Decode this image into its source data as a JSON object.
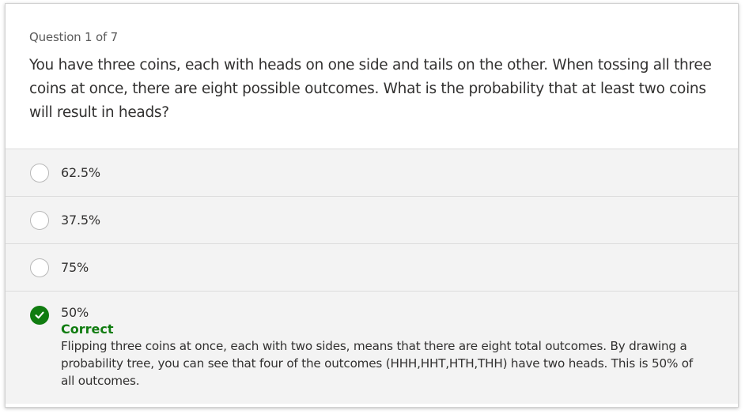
{
  "question": {
    "counter": "Question 1 of 7",
    "text": "You have three coins, each with heads on one side and tails on the other. When tossing all three coins at once, there are eight possible outcomes. What is the probability that at least two coins will result in heads?"
  },
  "options": [
    {
      "label": "62.5%"
    },
    {
      "label": "37.5%"
    },
    {
      "label": "75%"
    },
    {
      "label": "50%"
    }
  ],
  "feedback": {
    "status": "Correct",
    "explanation": "Flipping three coins at once, each with two sides, means that there are eight total outcomes. By drawing a probability tree, you can see that four of the outcomes (HHH,HHT,HTH,THH) have two heads. This is 50% of all outcomes.",
    "selected_option_index": 3
  },
  "colors": {
    "correct": "#107c10",
    "option_background": "#f3f3f3",
    "text": "#323130"
  },
  "icons": {
    "unselected": "radio-unselected-icon",
    "selected_correct": "checkmark-icon"
  }
}
